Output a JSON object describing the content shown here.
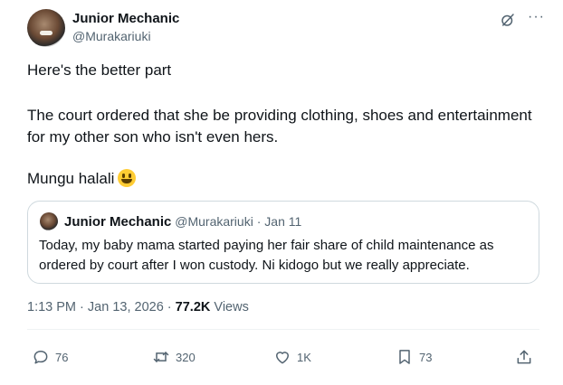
{
  "author": {
    "name": "Junior Mechanic",
    "handle": "@Murakariuki"
  },
  "icons": {
    "grok": "grok-icon",
    "more": "more-icon"
  },
  "tweet": {
    "line1": "Here's the better part",
    "line2": "The court ordered that she be providing clothing, shoes and entertainment for my other son who isn't even hers.",
    "line3": "Mungu halali",
    "emoji": "grinning-face"
  },
  "quote": {
    "name": "Junior Mechanic",
    "handle": "@Murakariuki",
    "separator": "·",
    "date": "Jan 11",
    "text": "Today, my baby mama started paying her fair share of child maintenance as ordered by court after I won custody. Ni kidogo but we really appreciate."
  },
  "meta": {
    "time": "1:13 PM",
    "sep1": "·",
    "date": "Jan 13, 2026",
    "sep2": "·",
    "views_count": "77.2K",
    "views_label": "Views"
  },
  "actions": {
    "reply_count": "76",
    "retweet_count": "320",
    "like_count": "1K",
    "bookmark_count": "73"
  },
  "colors": {
    "text": "#0f1419",
    "secondary": "#536471",
    "border": "#cfd9de"
  }
}
